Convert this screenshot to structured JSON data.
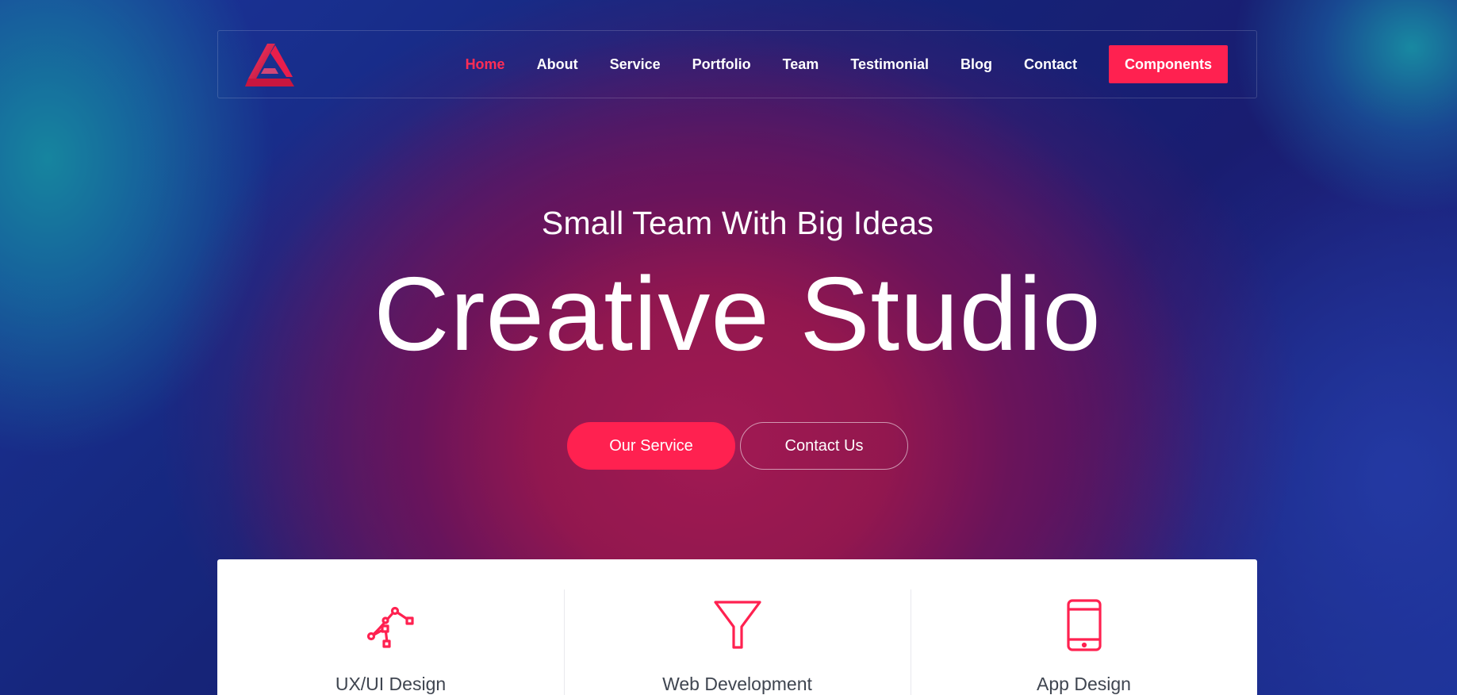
{
  "colors": {
    "accent": "#ff2150",
    "nav_active": "#ff2d55",
    "text_light": "#ffffff",
    "service_text": "#3f4550"
  },
  "navbar": {
    "logo_icon": "triangle-logo-icon",
    "links": [
      {
        "label": "Home",
        "active": true
      },
      {
        "label": "About",
        "active": false
      },
      {
        "label": "Service",
        "active": false
      },
      {
        "label": "Portfolio",
        "active": false
      },
      {
        "label": "Team",
        "active": false
      },
      {
        "label": "Testimonial",
        "active": false
      },
      {
        "label": "Blog",
        "active": false
      },
      {
        "label": "Contact",
        "active": false
      }
    ],
    "cta_label": "Components"
  },
  "hero": {
    "subtitle": "Small Team With Big Ideas",
    "title": "Creative Studio",
    "primary_button": "Our Service",
    "secondary_button": "Contact Us"
  },
  "services": [
    {
      "title": "UX/UI Design",
      "icon": "vector-pen-icon"
    },
    {
      "title": "Web Development",
      "icon": "funnel-icon"
    },
    {
      "title": "App Design",
      "icon": "mobile-phone-icon"
    }
  ]
}
